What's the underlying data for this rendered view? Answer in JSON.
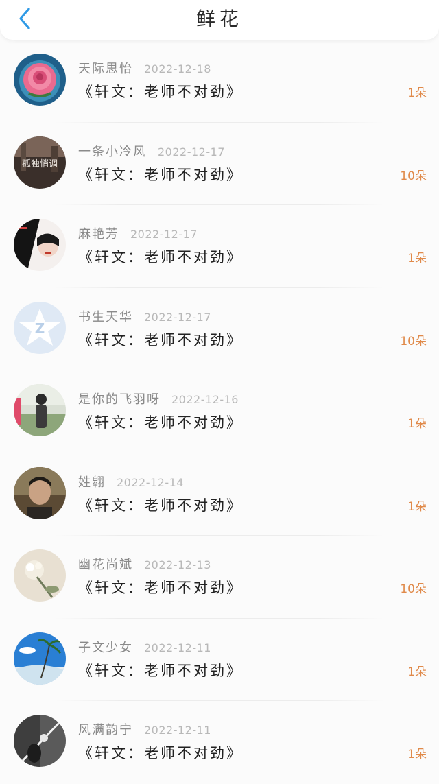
{
  "header": {
    "title": "鲜花",
    "back_icon": "chevron-left-icon"
  },
  "colors": {
    "accent": "#2f9ae6",
    "count": "#e08a4a",
    "name": "#8a8a8a",
    "date": "#b8b8b8",
    "work": "#222222"
  },
  "items": [
    {
      "name": "天际思怡",
      "date": "2022-12-18",
      "work": "《轩文：老师不对劲》",
      "count": "1朵"
    },
    {
      "name": "一条小冷风",
      "date": "2022-12-17",
      "work": "《轩文：老师不对劲》",
      "count": "10朵"
    },
    {
      "name": "麻艳芳",
      "date": "2022-12-17",
      "work": "《轩文：老师不对劲》",
      "count": "1朵"
    },
    {
      "name": "书生天华",
      "date": "2022-12-17",
      "work": "《轩文：老师不对劲》",
      "count": "10朵"
    },
    {
      "name": "是你的飞羽呀",
      "date": "2022-12-16",
      "work": "《轩文：老师不对劲》",
      "count": "1朵"
    },
    {
      "name": "姓翱",
      "date": "2022-12-14",
      "work": "《轩文：老师不对劲》",
      "count": "1朵"
    },
    {
      "name": "幽花尚斌",
      "date": "2022-12-13",
      "work": "《轩文：老师不对劲》",
      "count": "10朵"
    },
    {
      "name": "子文少女",
      "date": "2022-12-11",
      "work": "《轩文：老师不对劲》",
      "count": "1朵"
    },
    {
      "name": "风满韵宁",
      "date": "2022-12-11",
      "work": "《轩文：老师不对劲》",
      "count": "1朵"
    }
  ],
  "avatars": {
    "second_caption": "孤独悄调"
  }
}
